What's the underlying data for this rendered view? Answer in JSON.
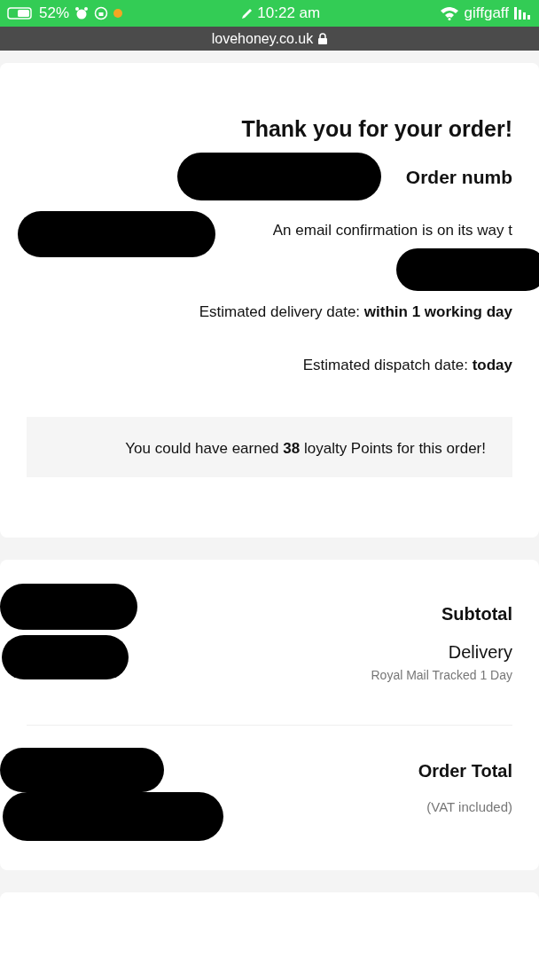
{
  "status_bar": {
    "carrier": "giffgaff",
    "time": "10:22 am",
    "battery": "52%"
  },
  "address_bar": {
    "url": "lovehoney.co.uk"
  },
  "confirmation": {
    "title": "Thank you for your order!",
    "order_number_label": "Order numb",
    "email_text": "An email confirmation is on its way t",
    "delivery_text": "Estimated delivery date: **within 1 working day**",
    "dispatch_text": "Estimated dispatch date: **today**",
    "loyalty_text": "You could have earned **38** loyalty Points for this order!"
  },
  "summary": {
    "rows": [
      {
        "kind": "bold",
        "label": "Subtotal"
      },
      {
        "kind": "plain",
        "label": "Delivery",
        "sublabel": "Royal Mail Tracked 1 Day"
      }
    ],
    "total": {
      "label": "Order Total",
      "sublabel": "(VAT included)"
    }
  }
}
